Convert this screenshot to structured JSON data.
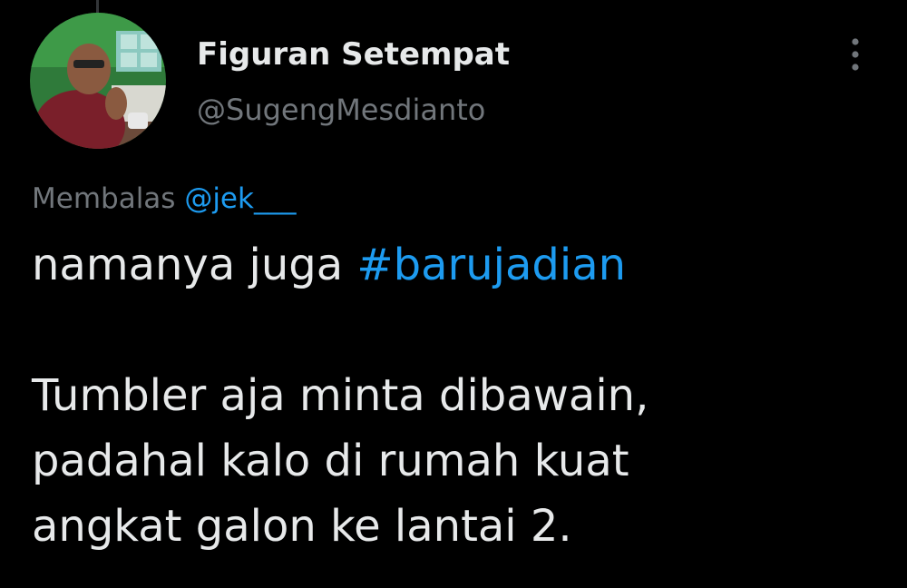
{
  "tweet": {
    "author": {
      "display_name": "Figuran Setempat",
      "handle": "@SugengMesdianto",
      "avatar": "avatar-photo"
    },
    "reply_to": {
      "prefix": "Membalas",
      "mention": "@jek___"
    },
    "text": {
      "line1_plain": "namanya juga ",
      "line1_hashtag": "#barujadian",
      "line2": "Tumbler aja minta dibawain,",
      "line3": "padahal kalo di rumah kuat",
      "line4": "angkat galon ke lantai 2."
    },
    "more_icon": "more-vertical-icon"
  },
  "colors": {
    "background": "#000000",
    "primary_text": "#e7e9ea",
    "secondary_text": "#71767b",
    "accent": "#1d9bf0"
  }
}
